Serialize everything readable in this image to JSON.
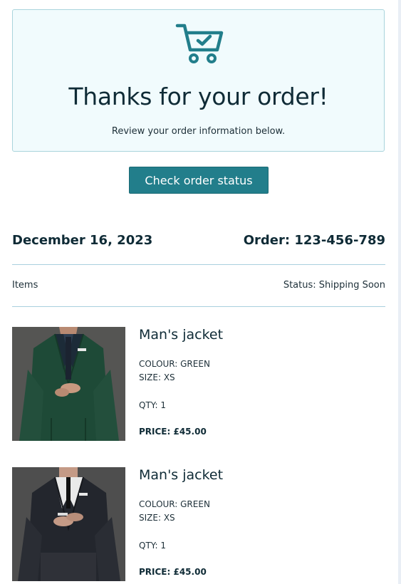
{
  "hero": {
    "icon": "shopping-cart-check-icon",
    "title": "Thanks for your order!",
    "subtitle": "Review your order information below."
  },
  "button": {
    "label": "Check order status"
  },
  "order": {
    "date": "December 16, 2023",
    "number": "Order: 123-456-789",
    "items_label": "Items",
    "status": "Status: Shipping Soon"
  },
  "products": [
    {
      "name": "Man's jacket",
      "colour": "COLOUR: GREEN",
      "size": "SIZE: XS",
      "qty": "QTY: 1",
      "price": "PRICE: £45.00"
    },
    {
      "name": "Man's jacket",
      "colour": "COLOUR: GREEN",
      "size": "SIZE: XS",
      "qty": "QTY: 1",
      "price": "PRICE: £45.00"
    }
  ],
  "colors": {
    "accent": "#227e8b",
    "hero_bg": "#f1fbfd",
    "text": "#0f2b36"
  }
}
